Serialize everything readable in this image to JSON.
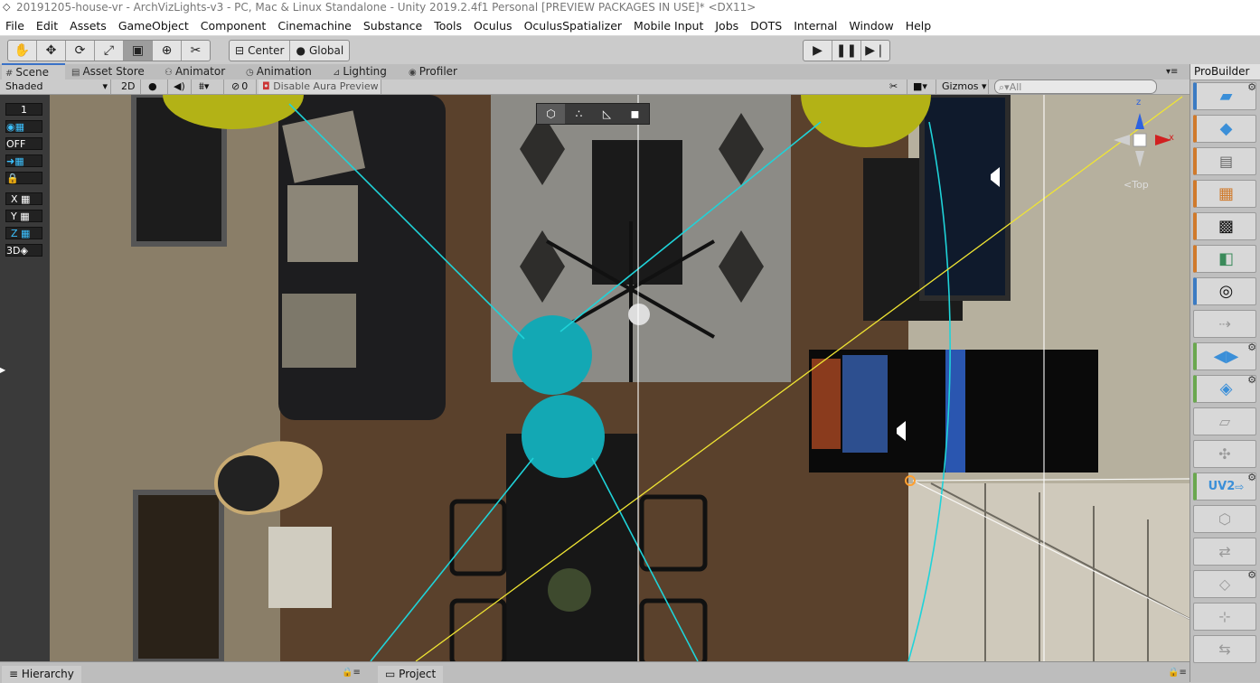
{
  "window": {
    "title": "20191205-house-vr - ArchVizLights-v3 - PC, Mac & Linux Standalone - Unity 2019.2.4f1 Personal [PREVIEW PACKAGES IN USE]* <DX11>"
  },
  "menu": [
    "File",
    "Edit",
    "Assets",
    "GameObject",
    "Component",
    "Cinemachine",
    "Substance",
    "Tools",
    "Oculus",
    "OculusSpatializer",
    "Mobile Input",
    "Jobs",
    "DOTS",
    "Internal",
    "Window",
    "Help"
  ],
  "toolbar": {
    "pivot": "Center",
    "space": "Global"
  },
  "tabs": [
    {
      "label": "Scene",
      "icon": "hash-icon"
    },
    {
      "label": "Asset Store",
      "icon": "store-icon"
    },
    {
      "label": "Animator",
      "icon": "animator-icon"
    },
    {
      "label": "Animation",
      "icon": "clock-icon"
    },
    {
      "label": "Lighting",
      "icon": "lighting-icon"
    },
    {
      "label": "Profiler",
      "icon": "profiler-icon"
    }
  ],
  "scene_bar": {
    "shading_mode": "Shaded",
    "mode_2d": "2D",
    "hidden_count": "0",
    "aura_label": "Disable Aura Preview",
    "gizmos": "Gizmos",
    "search_placeholder": "All"
  },
  "left_tools": {
    "layer": "1",
    "off": "OFF",
    "x": "X",
    "y": "Y",
    "z": "Z",
    "view3d": "3D"
  },
  "orientation": {
    "view": "Top",
    "axis_x": "x",
    "axis_z": "z"
  },
  "probuilder": {
    "title": "ProBuilder",
    "uv_label": "UV2"
  },
  "bottom": {
    "hierarchy": "Hierarchy",
    "project": "Project"
  },
  "colors": {
    "cyan_light_cone": "#1fd3d9",
    "yellow_ray": "#f0e533",
    "teal_sphere": "#13a8b4",
    "olive_sphere": "#b3b216",
    "selection_accent": "#3a72c7"
  }
}
